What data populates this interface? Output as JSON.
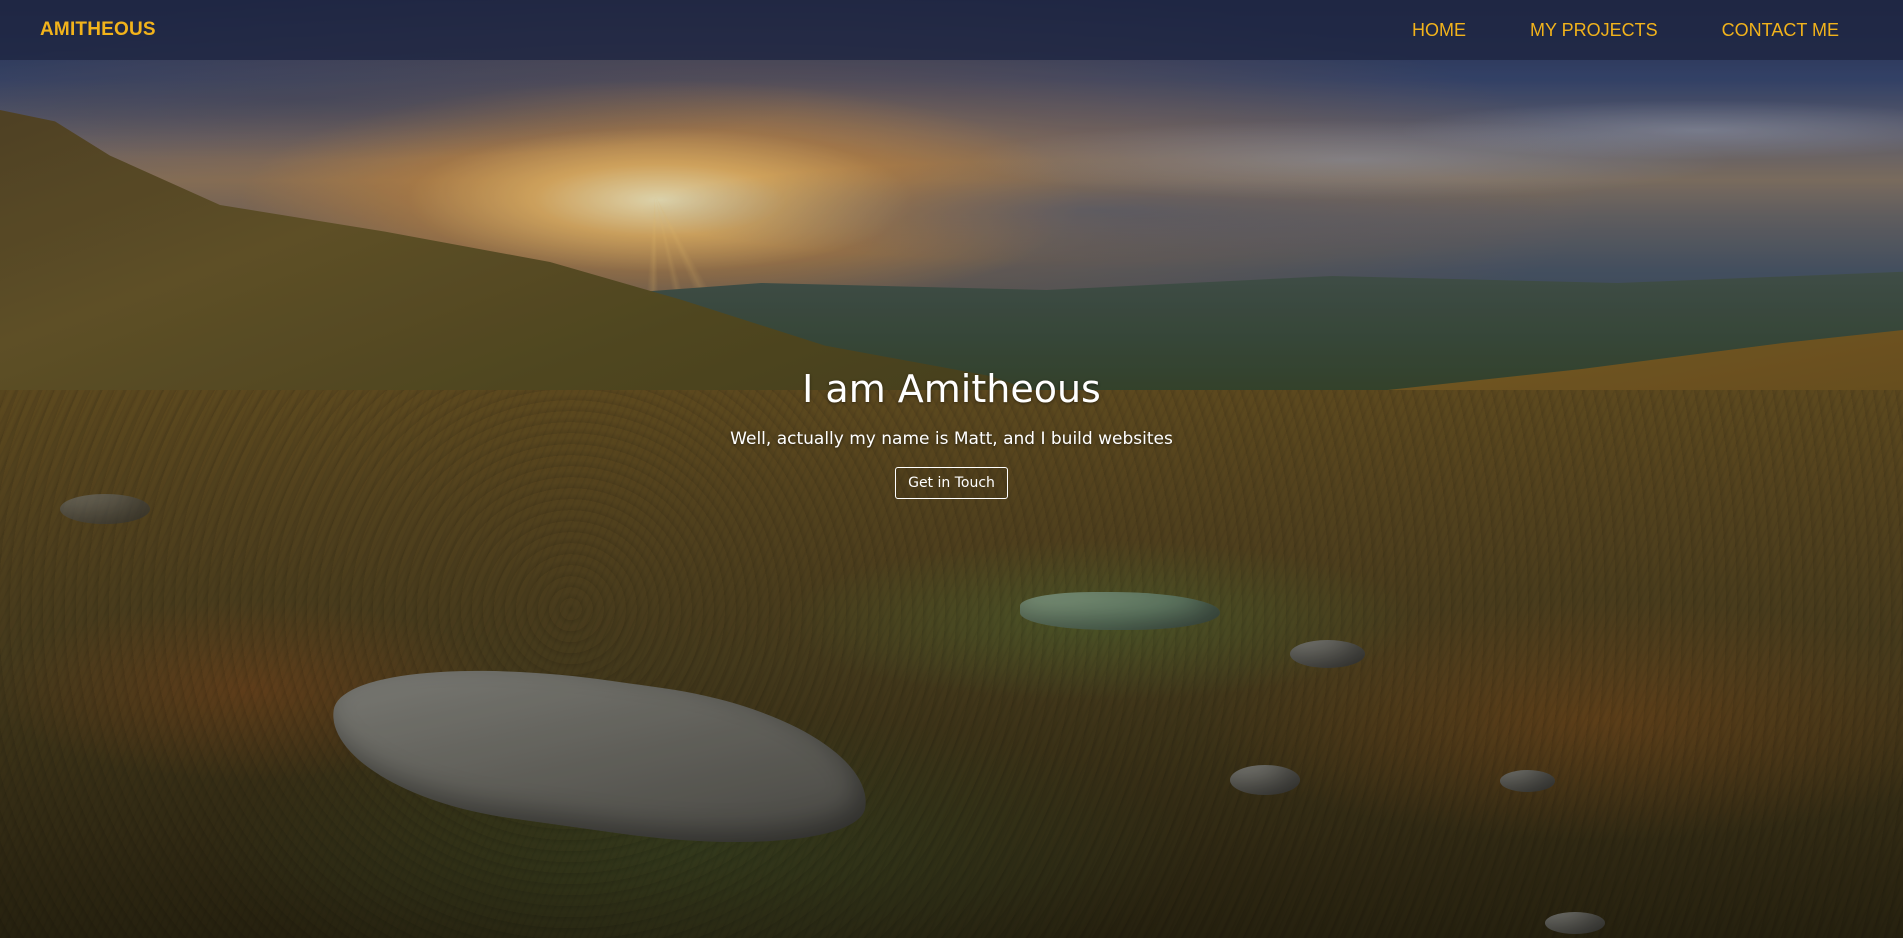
{
  "navbar": {
    "brand": "AMITHEOUS",
    "links": [
      {
        "label": "HOME"
      },
      {
        "label": "MY PROJECTS"
      },
      {
        "label": "CONTACT ME"
      }
    ]
  },
  "hero": {
    "title": "I am Amitheous",
    "subtitle": "Well, actually my name is Matt, and I build websites",
    "cta_label": "Get in Touch"
  },
  "colors": {
    "accent": "#f2b31b",
    "navbar_bg": "#1e2642",
    "text": "#ffffff"
  },
  "background": {
    "image_description_icon": "landscape-sunset-icon"
  }
}
